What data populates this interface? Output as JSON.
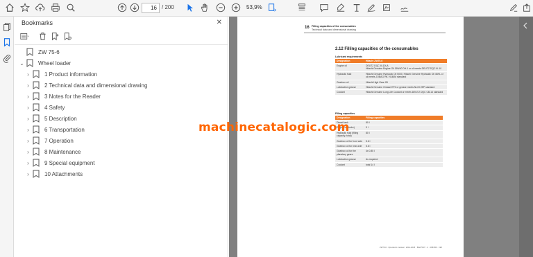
{
  "toolbar": {
    "page_current": "16",
    "page_total": "/ 200",
    "zoom": "53,9%"
  },
  "bookmarks": {
    "title": "Bookmarks",
    "items": [
      {
        "label": "ZW 75-6",
        "expander": ""
      },
      {
        "label": "Wheel loader",
        "expander": "⌄"
      },
      {
        "label": "1 Product information",
        "expander": "›"
      },
      {
        "label": "2 Technical data and dimensional drawing",
        "expander": "›"
      },
      {
        "label": "3 Notes for the Reader",
        "expander": "›"
      },
      {
        "label": "4 Safety",
        "expander": "›"
      },
      {
        "label": "5 Description",
        "expander": "›"
      },
      {
        "label": "6 Transportation",
        "expander": "›"
      },
      {
        "label": "7 Operation",
        "expander": "›"
      },
      {
        "label": "8 Maintenance",
        "expander": "›"
      },
      {
        "label": "9 Special equipment",
        "expander": "›"
      },
      {
        "label": "10 Attachments",
        "expander": "›"
      }
    ]
  },
  "document": {
    "page_number": "16",
    "header_title": "Filling capacities of the consumables",
    "header_sub": "Technical data and dimensional drawing",
    "section": "2.12   Filling capacities of the consumables",
    "lubricant_heading": "Lubricant requirements",
    "lubricant_table": {
      "headers": [
        "Designation",
        "Hitachi ZW75-6"
      ],
      "rows": [
        [
          "Engine oil",
          "DEUTZ DQC III-10LA\nHitachi Genuine Engine Oil 15W40 DH-1 or oil meets DEUTZ DQC III-10"
        ],
        [
          "Hydraulic fluid",
          "Hitachi Genuine Hydraulic Oil 5000, Hitachi Genuine Hydraulic Oil 46HL or oil meets JOBAG HK VG46M standard"
        ],
        [
          "Gearbox oil",
          "Hitachi High Gear Oil"
        ],
        [
          "Lubrication grease",
          "Hitachi Genuine Grease EP2 or grease meets NLGI 2EP standard"
        ],
        [
          "Coolant",
          "Hitachi Genuine Long Life Coolant or meets DEUTZ DQC CB-14 standard"
        ]
      ]
    },
    "capacities_heading": "Filling capacities",
    "capacities_table": {
      "headers": [
        "Designation",
        "Filling capacities"
      ],
      "rows": [
        [
          "Diesel tank",
          "80 l"
        ],
        [
          "Engine oil (turbo)",
          "9 l"
        ],
        [
          "Hydraulic fluid (filling capacity, total)",
          "80 l"
        ],
        [
          "Gearbox oil for front axle",
          "5.6 l"
        ],
        [
          "Gearbox oil for rear axle",
          "5.6 l"
        ],
        [
          "Gearbox oil for the planetary gears",
          "4x 0.85 l"
        ],
        [
          "Lubrication grease",
          "As required"
        ],
        [
          "Coolant",
          "total 14 l"
        ]
      ]
    },
    "footer": "ZW75-6 · Operator's manual · 2014-2018 · BA075/07 · 2 · 068/056 · 198",
    "watermark": "machinecatalogic.com"
  },
  "colors": {
    "table_header": "#f07c28",
    "watermark": "#ff6600",
    "active_tool": "#1a73e8"
  }
}
